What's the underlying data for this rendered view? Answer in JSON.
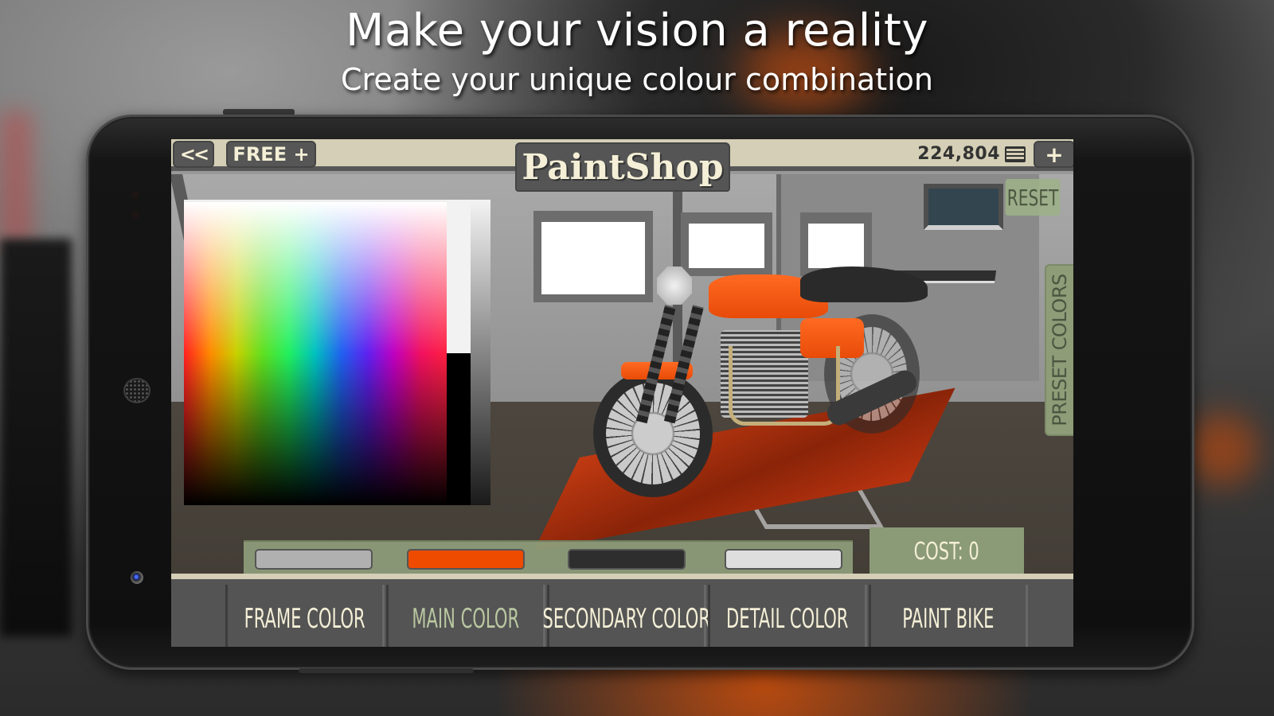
{
  "promo": {
    "headline": "Make your vision a reality",
    "subheadline": "Create your unique colour combination"
  },
  "game": {
    "topbar": {
      "back_label": "<<",
      "free_label": "FREE +",
      "title": "PaintShop",
      "currency": "224,804",
      "currency_icon": "cash-icon",
      "add_label": "+"
    },
    "reset_label": "RESET",
    "preset_colors_label": "PRESET COLORS",
    "swatches": [
      {
        "name": "frame",
        "color": "#b0b0b0"
      },
      {
        "name": "main",
        "color": "#ee4a00"
      },
      {
        "name": "secondary",
        "color": "#2e2e2e"
      },
      {
        "name": "detail",
        "color": "#dedede"
      }
    ],
    "cost_label": "COST: 0",
    "tabs": [
      {
        "label": "FRAME COLOR",
        "active": false
      },
      {
        "label": "MAIN COLOR",
        "active": true
      },
      {
        "label": "SECONDARY COLOR",
        "active": false
      },
      {
        "label": "DETAIL COLOR",
        "active": false
      },
      {
        "label": "PAINT BIKE",
        "active": false
      }
    ],
    "colors": {
      "topbar_bg": "#d4cfb6",
      "button_dark": "#565656",
      "text_cream": "#f4efd6",
      "active_tab_text": "#b9c7a1",
      "panel_green": "#8b9a77"
    }
  }
}
